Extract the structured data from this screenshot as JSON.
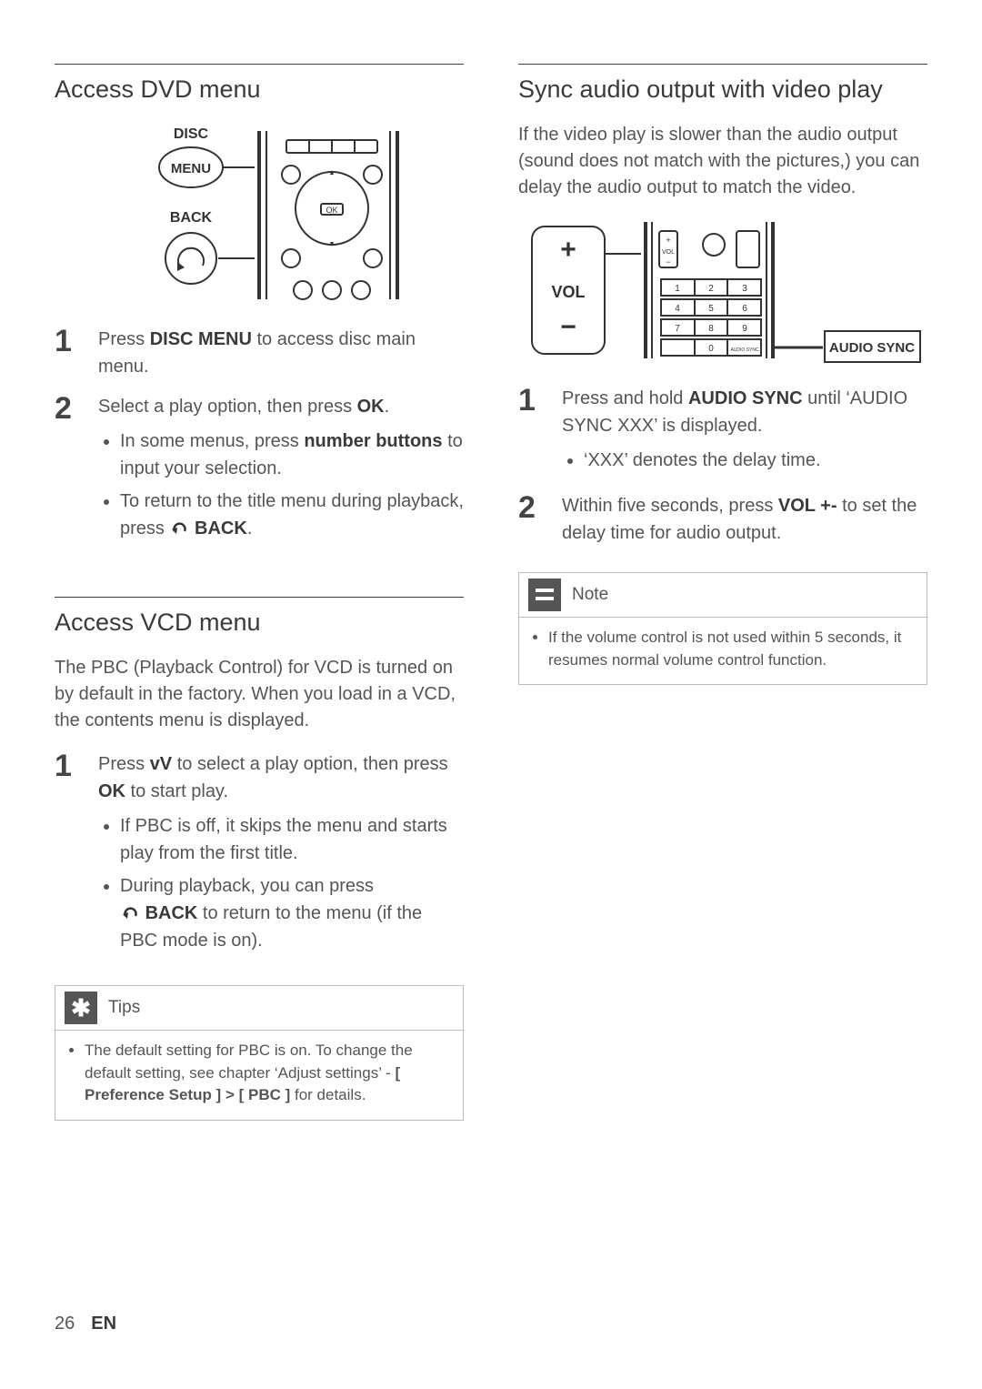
{
  "left": {
    "section1": {
      "heading": "Access DVD menu",
      "diagram_labels": {
        "disc": "DISC",
        "menu": "MENU",
        "back": "BACK"
      },
      "steps": [
        {
          "num": "1",
          "prefix": "Press ",
          "bold": "DISC MENU",
          "suffix": " to access disc main menu."
        },
        {
          "num": "2",
          "prefix": "Select a play option, then press ",
          "bold": "OK",
          "suffix": ".",
          "sub": [
            {
              "prefix": "In some menus, press ",
              "bold": "number buttons",
              "suffix": " to input your selection."
            },
            {
              "prefix": "To return to the title menu during playback, press ",
              "glyph": "back",
              "bold": " BACK",
              "suffix": "."
            }
          ]
        }
      ]
    },
    "section2": {
      "heading": "Access VCD menu",
      "intro": "The PBC (Playback Control) for VCD is turned on by default in the factory.  When you load in a VCD, the contents menu is displayed.",
      "steps": [
        {
          "num": "1",
          "prefix": "Press ",
          "bold": "vV",
          "mid": "  to select a play option, then press ",
          "bold2": "OK",
          "suffix": " to start play.",
          "sub": [
            {
              "text": "If PBC is off, it skips the menu and starts play from the first title."
            },
            {
              "prefix": "During playback, you can press ",
              "glyph": "back",
              "bold": " BACK",
              "suffix": " to return to the menu (if the PBC mode is on)."
            }
          ]
        }
      ],
      "tips": {
        "label": "Tips",
        "item_prefix": "The default setting for PBC is on. To change the default setting, see chapter ‘Adjust settings’ - ",
        "item_bold": "[ Preference Setup ] > [ PBC ]",
        "item_suffix": " for details."
      }
    }
  },
  "right": {
    "section1": {
      "heading": "Sync audio output with video play",
      "intro": "If the video play is slower than the audio output (sound does not match with the pictures,) you can delay the audio output to match the video.",
      "diagram_labels": {
        "vol": "VOL",
        "audiosync": "AUDIO SYNC"
      },
      "steps": [
        {
          "num": "1",
          "prefix": "Press and hold ",
          "bold": "AUDIO SYNC",
          "suffix": " until ‘AUDIO SYNC XXX’ is displayed.",
          "sub": [
            {
              "text": "‘XXX’ denotes the delay time."
            }
          ]
        },
        {
          "num": "2",
          "prefix": "Within five seconds, press ",
          "bold": "VOL +-",
          "suffix": "       to set the delay time for audio output."
        }
      ],
      "note": {
        "label": "Note",
        "item": "If the volume control is not used within 5 seconds, it resumes normal volume control function."
      }
    }
  },
  "footer": {
    "page": "26",
    "lang": "EN"
  }
}
